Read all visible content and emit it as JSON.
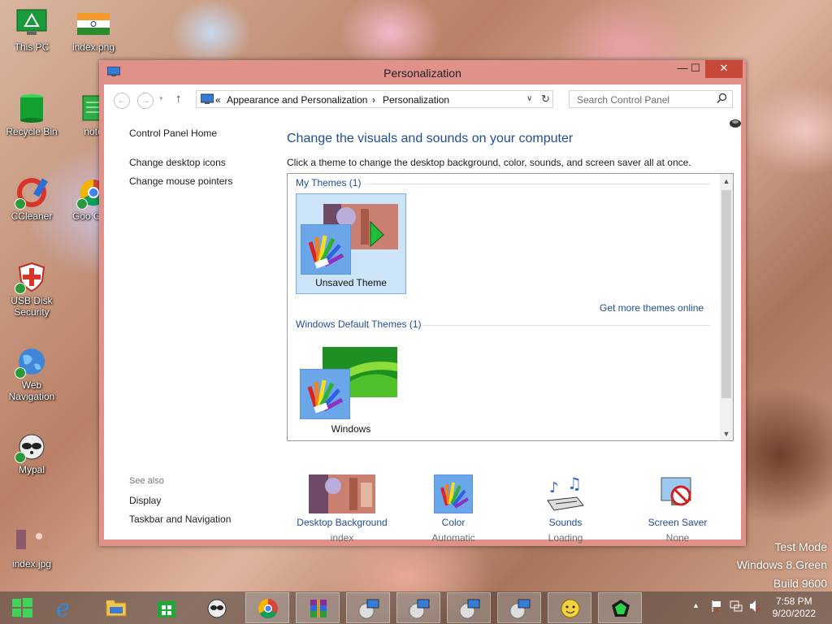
{
  "desktop": {
    "icons": [
      {
        "label": "This PC"
      },
      {
        "label": "index.png"
      },
      {
        "label": "Recycle Bin"
      },
      {
        "label": "note"
      },
      {
        "label": "CCleaner"
      },
      {
        "label": "Goo Chro"
      },
      {
        "label": "USB Disk Security"
      },
      {
        "label": "Web Navigation"
      },
      {
        "label": "Mypal"
      },
      {
        "label": "index.jpg"
      }
    ],
    "watermark": [
      "Test Mode",
      "Windows 8.Green",
      "Build 9600"
    ]
  },
  "window": {
    "title": "Personalization",
    "controls": {
      "minimize": "—",
      "maximize": "☐",
      "close": "✕"
    },
    "address": {
      "prefix": "«",
      "crumbs": [
        "Appearance and Personalization",
        "Personalization"
      ],
      "separator": "›"
    },
    "search": {
      "placeholder": "Search Control Panel"
    },
    "left_nav": {
      "home": "Control Panel Home",
      "links": [
        "Change desktop icons",
        "Change mouse pointers"
      ],
      "see_also_title": "See also",
      "see_also": [
        "Display",
        "Taskbar and Navigation"
      ]
    },
    "main": {
      "heading": "Change the visuals and sounds on your computer",
      "description": "Click a theme to change the desktop background, color, sounds, and screen saver all at once.",
      "groups": [
        {
          "title": "My Themes (1)",
          "tiles": [
            {
              "label": "Unsaved Theme",
              "selected": true
            }
          ]
        },
        {
          "title": "Windows Default Themes (1)",
          "tiles": [
            {
              "label": "Windows",
              "selected": false
            }
          ]
        }
      ],
      "get_more_link": "Get more themes online"
    },
    "bottom": [
      {
        "label": "Desktop Background",
        "sub": "index"
      },
      {
        "label": "Color",
        "sub": "Automatic"
      },
      {
        "label": "Sounds",
        "sub": "Loading"
      },
      {
        "label": "Screen Saver",
        "sub": "None"
      }
    ]
  },
  "taskbar": {
    "clock": {
      "time": "7:58 PM",
      "date": "9/20/2022"
    }
  },
  "colors": {
    "link": "#1f4e9a",
    "titlebar": "#e0918a",
    "close": "#c7493a",
    "selection": "#cce4f7"
  }
}
